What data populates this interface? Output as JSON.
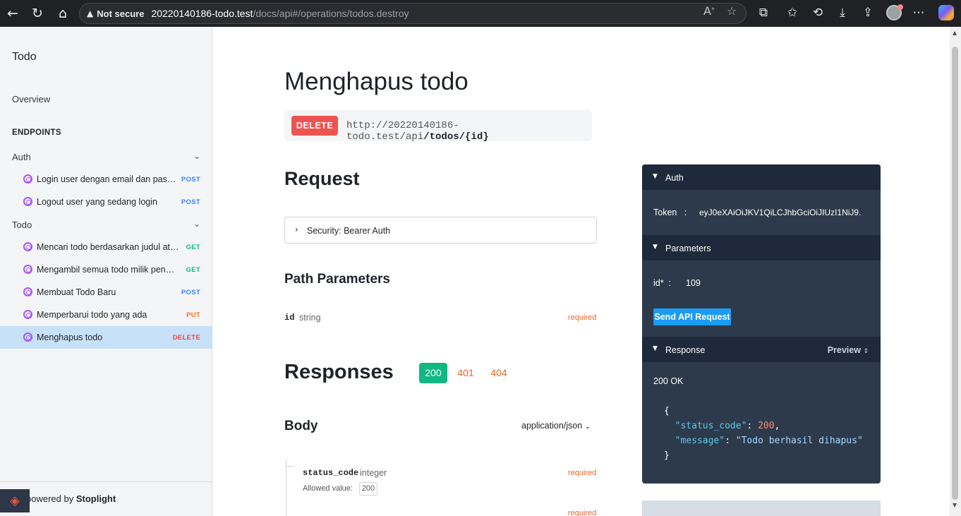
{
  "browser": {
    "security_label": "Not secure",
    "url_host": "20220140186-todo.test",
    "url_path": "/docs/api#/operations/todos.destroy",
    "icons": [
      "back-icon",
      "reload-icon",
      "home-icon",
      "read-aloud-icon",
      "favorite-star-icon",
      "extensions-icon",
      "favorites-icon",
      "history-icon",
      "downloads-icon",
      "share-icon",
      "profile-avatar",
      "more-icon",
      "copilot-icon"
    ]
  },
  "sidebar": {
    "title": "Todo",
    "overview": "Overview",
    "endpoints_heading": "ENDPOINTS",
    "groups": [
      {
        "label": "Auth",
        "items": [
          {
            "label": "Login user dengan email dan password",
            "method": "POST"
          },
          {
            "label": "Logout user yang sedang login",
            "method": "POST"
          }
        ]
      },
      {
        "label": "Todo",
        "items": [
          {
            "label": "Mencari todo berdasarkan judul atau deskripsi",
            "method": "GET"
          },
          {
            "label": "Mengambil semua todo milik pengguna",
            "method": "GET"
          },
          {
            "label": "Membuat Todo Baru",
            "method": "POST"
          },
          {
            "label": "Memperbarui todo yang ada",
            "method": "PUT"
          },
          {
            "label": "Menghapus todo",
            "method": "DELETE",
            "active": true
          }
        ]
      }
    ],
    "powered_prefix": "powered by",
    "powered_brand": "Stoplight"
  },
  "main": {
    "title": "Menghapus todo",
    "method": "DELETE",
    "url_base": "http://20220140186-todo.test/api",
    "url_path": "/todos/{id}",
    "request_heading": "Request",
    "security_label": "Security: Bearer Auth",
    "path_params_heading": "Path Parameters",
    "param": {
      "name": "id",
      "type": "string",
      "required": "required"
    },
    "responses_heading": "Responses",
    "response_codes": [
      "200",
      "401",
      "404"
    ],
    "body_heading": "Body",
    "content_type": "application/json",
    "field": {
      "name": "status_code",
      "type": "integer",
      "required": "required",
      "allowed_label": "Allowed value:",
      "allowed_value": "200"
    },
    "field2_required": "required"
  },
  "panel": {
    "auth_label": "Auth",
    "token_label": "Token",
    "token_colon": ":",
    "token_value": "eyJ0eXAiOiJKV1QiLCJhbGciOiJIUzI1NiJ9.",
    "params_label": "Parameters",
    "id_label": "id*",
    "id_colon": ":",
    "id_value": "109",
    "send_button": "Send API Request",
    "response_label": "Response",
    "preview_label": "Preview",
    "status_text": "200 OK",
    "json": {
      "open": "{",
      "k1": "\"status_code\"",
      "v1": "200",
      "k2": "\"message\"",
      "v2": "\"Todo berhasil dihapus\"",
      "close": "}"
    }
  },
  "colors": {
    "delete": "#ef5350",
    "accent": "#1a9cf5",
    "success": "#10b981",
    "sidebar_active": "#c7e1f8"
  }
}
